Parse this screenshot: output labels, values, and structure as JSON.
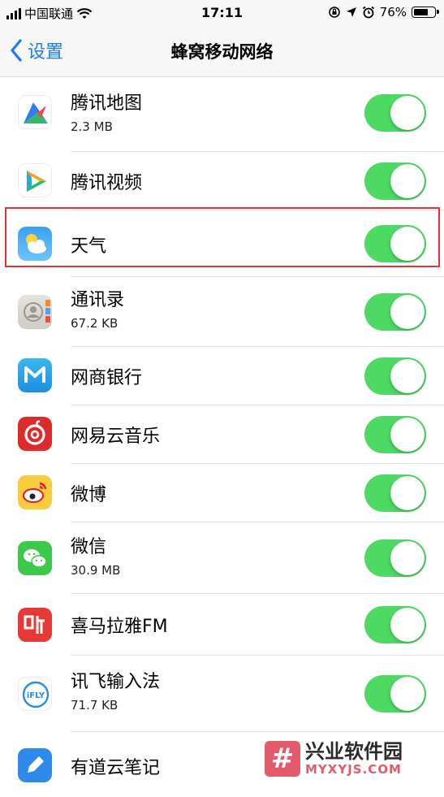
{
  "status_bar": {
    "carrier": "中国联通",
    "time": "17:11",
    "battery_text": "76%",
    "battery_level": 0.76
  },
  "nav": {
    "back_label": "设置",
    "title": "蜂窝移动网络"
  },
  "apps": [
    {
      "name": "腾讯地图",
      "size": "2.3 MB",
      "icon": "tencent-map-icon",
      "enabled": true
    },
    {
      "name": "腾讯视频",
      "size": "",
      "icon": "tencent-video-icon",
      "enabled": true
    },
    {
      "name": "天气",
      "size": "",
      "icon": "weather-icon",
      "enabled": true
    },
    {
      "name": "通讯录",
      "size": "67.2 KB",
      "icon": "contacts-icon",
      "enabled": true
    },
    {
      "name": "网商银行",
      "size": "",
      "icon": "mybank-icon",
      "enabled": true
    },
    {
      "name": "网易云音乐",
      "size": "",
      "icon": "netease-music-icon",
      "enabled": true
    },
    {
      "name": "微博",
      "size": "",
      "icon": "weibo-icon",
      "enabled": true
    },
    {
      "name": "微信",
      "size": "30.9 MB",
      "icon": "wechat-icon",
      "enabled": true
    },
    {
      "name": "喜马拉雅FM",
      "size": "",
      "icon": "ximalaya-icon",
      "enabled": true
    },
    {
      "name": "讯飞输入法",
      "size": "71.7 KB",
      "icon": "iflytek-icon",
      "enabled": true
    },
    {
      "name": "有道云笔记",
      "size": "",
      "icon": "youdao-note-icon",
      "enabled": true
    }
  ],
  "watermark": {
    "title": "兴业软件园",
    "url": "MYXYJS.COM"
  },
  "colors": {
    "accent": "#1a7cf5",
    "switch_on": "#4cd964",
    "highlight": "#e23434"
  }
}
